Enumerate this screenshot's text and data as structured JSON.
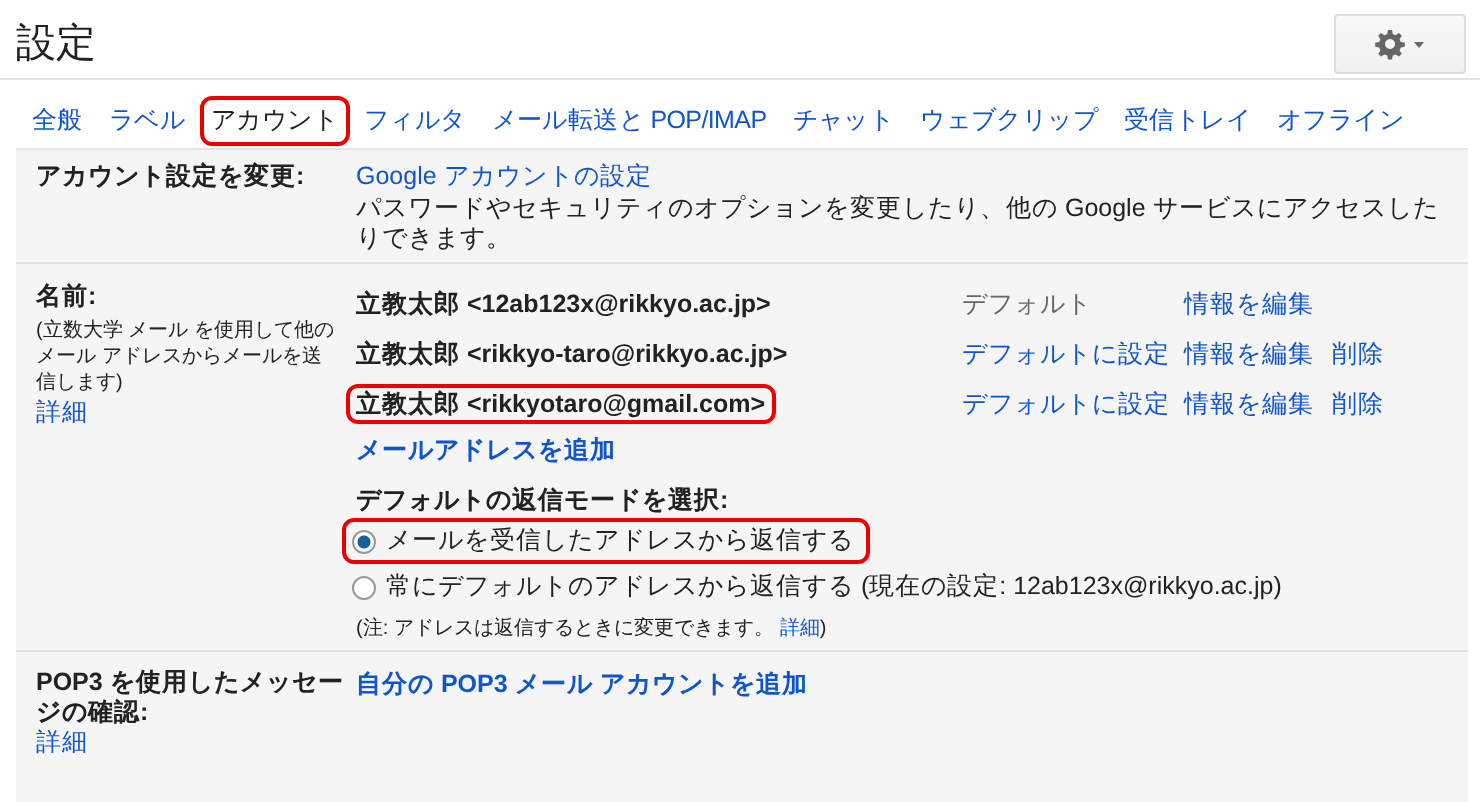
{
  "title": "設定",
  "tabs": [
    {
      "label": "全般",
      "selected": false,
      "highlighted": false
    },
    {
      "label": "ラベル",
      "selected": false,
      "highlighted": false
    },
    {
      "label": "アカウント",
      "selected": true,
      "highlighted": true
    },
    {
      "label": "フィルタ",
      "selected": false,
      "highlighted": false
    },
    {
      "label": "メール転送と POP/IMAP",
      "selected": false,
      "highlighted": false
    },
    {
      "label": "チャット",
      "selected": false,
      "highlighted": false
    },
    {
      "label": "ウェブクリップ",
      "selected": false,
      "highlighted": false
    },
    {
      "label": "受信トレイ",
      "selected": false,
      "highlighted": false
    },
    {
      "label": "オフライン",
      "selected": false,
      "highlighted": false
    }
  ],
  "account_settings": {
    "label": "アカウント設定を変更:",
    "link": "Google アカウントの設定",
    "description": "パスワードやセキュリティのオプションを変更したり、他の Google サービスにアクセスしたりできます。"
  },
  "send_as": {
    "label": "名前:",
    "hint": "(立数大学 メール を使用して他のメール アドレスからメールを送信します)",
    "details_link": "詳細",
    "addresses": [
      {
        "address": "立教太郎 <12ab123x@rikkyo.ac.jp>",
        "highlighted": false,
        "status": "デフォルト",
        "edit": "情報を編集"
      },
      {
        "address": "立教太郎 <rikkyo-taro@rikkyo.ac.jp>",
        "highlighted": false,
        "set_default": "デフォルトに設定",
        "edit": "情報を編集",
        "delete": "削除"
      },
      {
        "address": "立教太郎 <rikkyotaro@gmail.com>",
        "highlighted": true,
        "set_default": "デフォルトに設定",
        "edit": "情報を編集",
        "delete": "削除"
      }
    ],
    "add_link": "メールアドレスを追加",
    "reply_heading": "デフォルトの返信モードを選択:",
    "reply_options": [
      {
        "label": "メールを受信したアドレスから返信する",
        "selected": true,
        "highlighted": true
      },
      {
        "label": "常にデフォルトのアドレスから返信する (現在の設定: 12ab123x@rikkyo.ac.jp)",
        "selected": false,
        "highlighted": false
      }
    ],
    "note": "(注: アドレスは返信するときに変更できます。",
    "note_link": "詳細",
    "note_end": ")"
  },
  "pop3": {
    "label": "POP3 を使用したメッセージの確認:",
    "details_link": "詳細",
    "add_link": "自分の POP3 メール アカウントを追加"
  }
}
